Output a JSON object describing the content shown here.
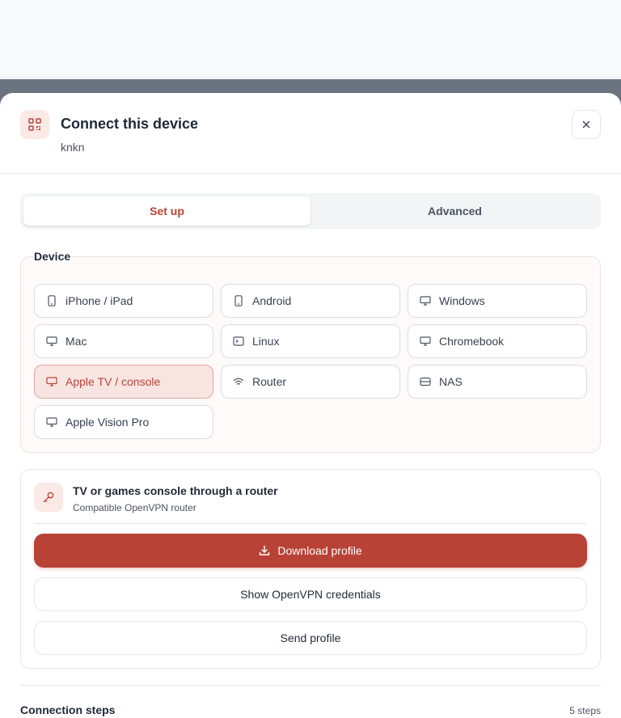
{
  "dialog": {
    "title": "Connect this device",
    "subtitle": "knkn",
    "close_icon": "close-icon",
    "header_icon": "qr-code-icon",
    "accent": "#b94236"
  },
  "tabs": [
    {
      "label": "Set up",
      "active": true
    },
    {
      "label": "Advanced",
      "active": false
    }
  ],
  "device_section": {
    "legend": "Device",
    "items": [
      {
        "label": "iPhone / iPad",
        "icon": "phone-icon"
      },
      {
        "label": "Android",
        "icon": "phone-icon"
      },
      {
        "label": "Windows",
        "icon": "monitor-icon"
      },
      {
        "label": "Mac",
        "icon": "monitor-icon"
      },
      {
        "label": "Linux",
        "icon": "terminal-icon"
      },
      {
        "label": "Chromebook",
        "icon": "monitor-icon"
      },
      {
        "label": "Apple TV / console",
        "icon": "tv-icon",
        "selected": true
      },
      {
        "label": "Router",
        "icon": "wifi-icon"
      },
      {
        "label": "NAS",
        "icon": "storage-icon"
      },
      {
        "label": "Apple Vision Pro",
        "icon": "monitor-icon"
      }
    ]
  },
  "profile": {
    "icon": "key-icon",
    "title": "TV or games console through a router",
    "subtitle": "Compatible OpenVPN router",
    "download_label": "Download profile",
    "download_icon": "download-icon",
    "show_credentials_label": "Show OpenVPN credentials",
    "send_label": "Send profile"
  },
  "steps": {
    "title": "Connection steps",
    "count": "5 steps"
  }
}
